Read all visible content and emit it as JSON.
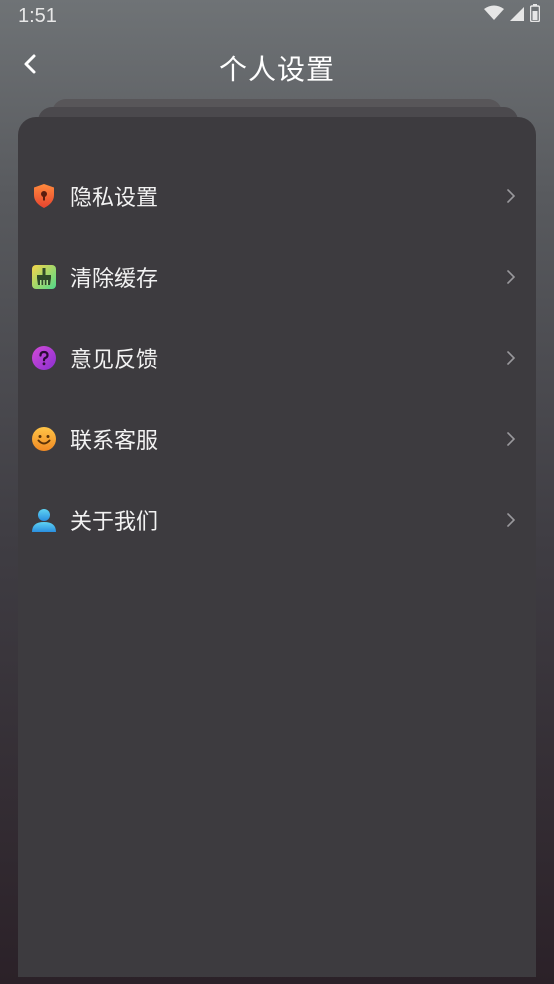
{
  "status_bar": {
    "time": "1:51",
    "icons": [
      "wifi-icon",
      "cell-signal-icon",
      "battery-icon"
    ]
  },
  "header": {
    "title": "个人设置",
    "back_icon": "chevron-left-icon"
  },
  "menu": {
    "items": [
      {
        "label": "隐私设置",
        "icon": "shield-lock-icon",
        "color": "#f2663a"
      },
      {
        "label": "清除缓存",
        "icon": "broom-icon",
        "color": "#7ed957"
      },
      {
        "label": "意见反馈",
        "icon": "question-icon",
        "color": "#b83fd8"
      },
      {
        "label": "联系客服",
        "icon": "smiley-icon",
        "color": "#f7a233"
      },
      {
        "label": "关于我们",
        "icon": "user-icon",
        "color": "#3fb6e8"
      }
    ],
    "chevron_icon": "chevron-right-icon"
  },
  "colors": {
    "card_background": "#3d3b3f",
    "text": "#f2f2f2"
  }
}
